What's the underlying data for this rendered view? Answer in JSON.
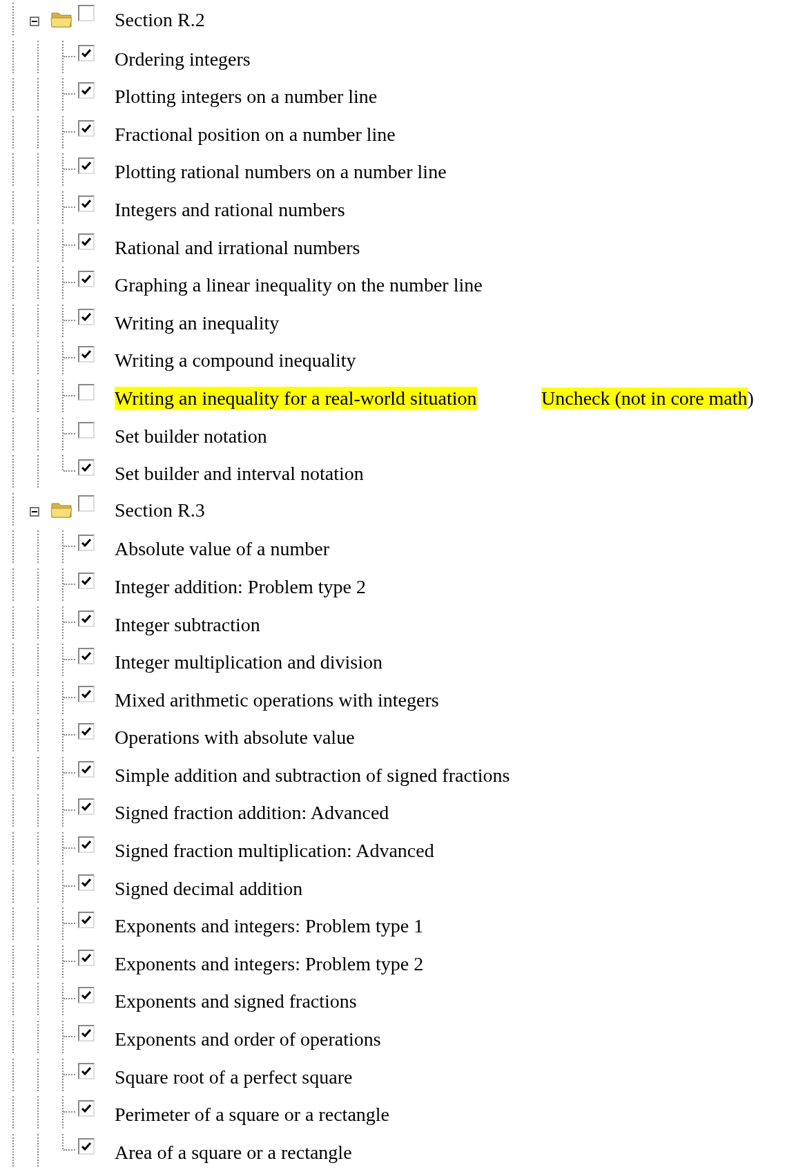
{
  "tree": [
    {
      "label": "Section R.2",
      "expanded": true,
      "checked": false,
      "children": [
        {
          "label": "Ordering integers",
          "checked": true
        },
        {
          "label": "Plotting integers on a number line",
          "checked": true
        },
        {
          "label": "Fractional position on a number line",
          "checked": true
        },
        {
          "label": "Plotting rational numbers on a number line",
          "checked": true
        },
        {
          "label": "Integers and rational numbers",
          "checked": true
        },
        {
          "label": "Rational and irrational numbers",
          "checked": true
        },
        {
          "label": "Graphing a linear inequality on the number line",
          "checked": true
        },
        {
          "label": "Writing an inequality",
          "checked": true
        },
        {
          "label": "Writing a compound inequality",
          "checked": true
        },
        {
          "label": "Writing an inequality for a real-world situation",
          "checked": false,
          "highlighted": true,
          "note": {
            "text": "Uncheck (not in core math",
            "tail": ")"
          }
        },
        {
          "label": "Set builder notation",
          "checked": false
        },
        {
          "label": "Set builder and interval notation",
          "checked": true
        }
      ]
    },
    {
      "label": "Section R.3",
      "expanded": true,
      "checked": false,
      "children": [
        {
          "label": "Absolute value of a number",
          "checked": true
        },
        {
          "label": "Integer addition: Problem type 2",
          "checked": true
        },
        {
          "label": "Integer subtraction",
          "checked": true
        },
        {
          "label": "Integer multiplication and division",
          "checked": true
        },
        {
          "label": "Mixed arithmetic operations with integers",
          "checked": true
        },
        {
          "label": "Operations with absolute value",
          "checked": true
        },
        {
          "label": "Simple addition and subtraction of signed fractions",
          "checked": true
        },
        {
          "label": "Signed fraction addition: Advanced",
          "checked": true
        },
        {
          "label": "Signed fraction multiplication: Advanced",
          "checked": true
        },
        {
          "label": "Signed decimal addition",
          "checked": true
        },
        {
          "label": "Exponents and integers: Problem type 1",
          "checked": true
        },
        {
          "label": "Exponents and integers: Problem type 2",
          "checked": true
        },
        {
          "label": "Exponents and signed fractions",
          "checked": true
        },
        {
          "label": "Exponents and order of operations",
          "checked": true
        },
        {
          "label": "Square root of a perfect square",
          "checked": true
        },
        {
          "label": "Perimeter of a square or a rectangle",
          "checked": true
        },
        {
          "label": "Area of a square or a rectangle",
          "checked": true
        }
      ]
    }
  ]
}
